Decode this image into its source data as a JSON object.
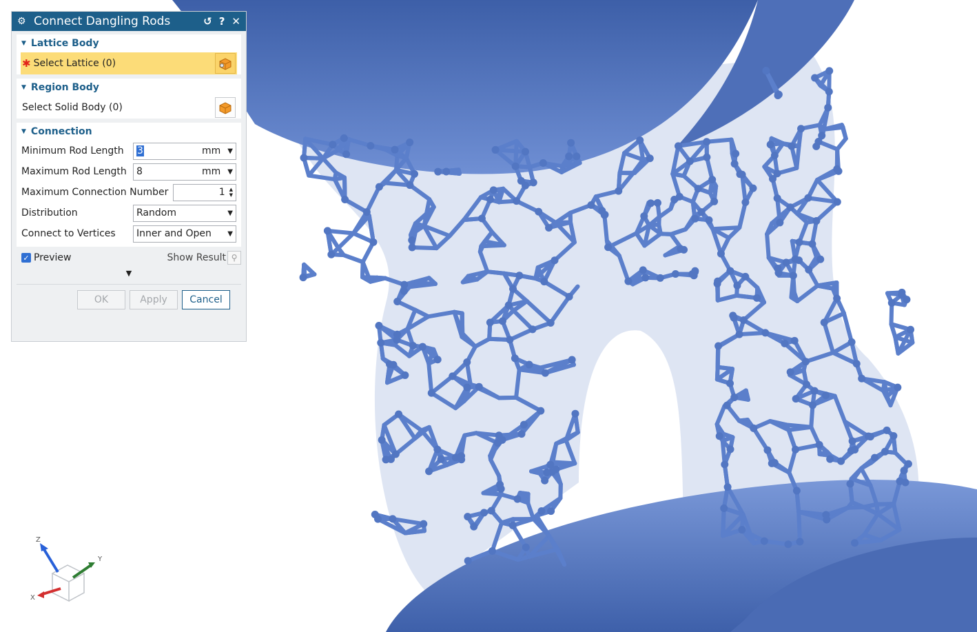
{
  "dialog": {
    "title": "Connect Dangling Rods",
    "title_buttons": {
      "reset": "↺",
      "help": "?",
      "close": "✕"
    },
    "lattice_body": {
      "header": "Lattice Body",
      "select_label": "Select Lattice (0)",
      "required_mark": "✱"
    },
    "region_body": {
      "header": "Region Body",
      "select_label": "Select Solid Body (0)"
    },
    "connection": {
      "header": "Connection",
      "min_rod_length": {
        "label": "Minimum Rod Length",
        "value": "3",
        "unit": "mm"
      },
      "max_rod_length": {
        "label": "Maximum Rod Length",
        "value": "8",
        "unit": "mm"
      },
      "max_connection_number": {
        "label": "Maximum Connection Number",
        "value": "1"
      },
      "distribution": {
        "label": "Distribution",
        "value": "Random"
      },
      "connect_to_vertices": {
        "label": "Connect to Vertices",
        "value": "Inner and Open"
      }
    },
    "preview": {
      "label": "Preview",
      "checked": true,
      "show_result_label": "Show Result"
    },
    "buttons": {
      "ok": "OK",
      "apply": "Apply",
      "cancel": "Cancel"
    }
  },
  "triad": {
    "z": "Z",
    "y": "Y",
    "x": "X"
  },
  "colors": {
    "title_bar": "#1d5f8a",
    "accent": "#1d5f8a",
    "active_selection": "#fcdc78",
    "rod_blue": "#5b7fcb",
    "body_translucent": "#cfd9ec",
    "z_axis": "#2860d8",
    "y_axis": "#2e7d32",
    "x_axis": "#d32f2f"
  },
  "icons": {
    "gear": "gear-icon",
    "lattice": "lattice-body-icon",
    "solid": "solid-body-icon",
    "magnifier": "magnifier-icon"
  }
}
